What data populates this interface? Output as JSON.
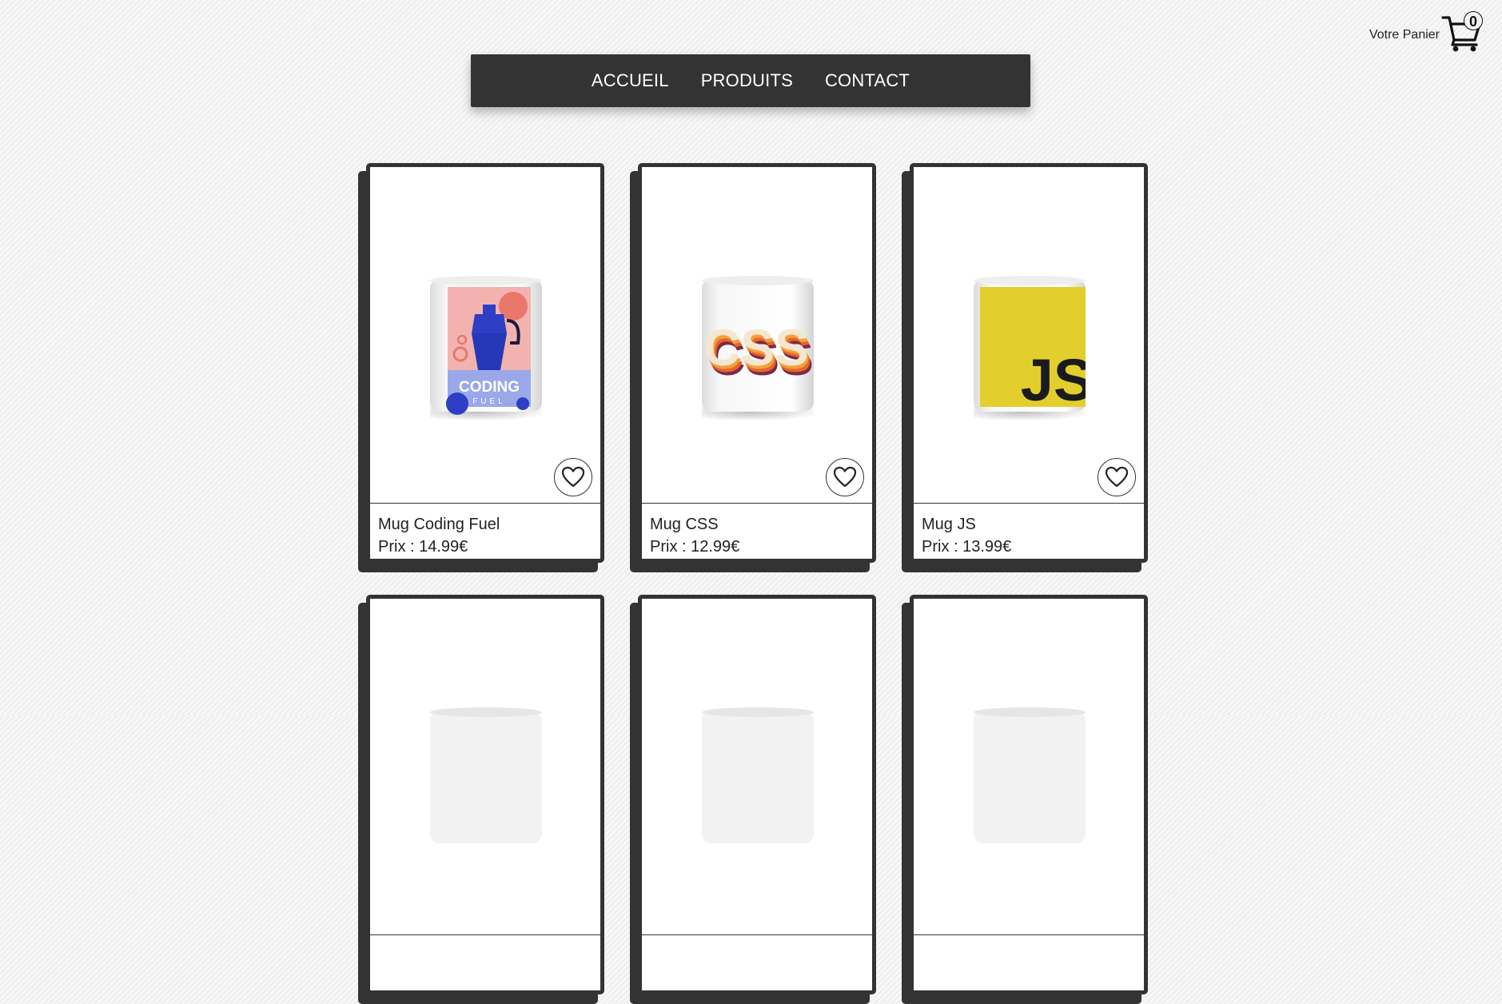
{
  "cart": {
    "label": "Votre Panier",
    "count": "0",
    "icon": "cart-icon"
  },
  "nav": {
    "items": [
      {
        "label": "ACCUEIL"
      },
      {
        "label": "PRODUITS"
      },
      {
        "label": "CONTACT"
      }
    ]
  },
  "products": [
    {
      "name": "Mug Coding Fuel",
      "price": "Prix : 14.99€",
      "design": "coding-fuel",
      "mug_text": "CODING",
      "mug_subtext": "FUEL"
    },
    {
      "name": "Mug CSS",
      "price": "Prix : 12.99€",
      "design": "css",
      "mug_text": "CSS"
    },
    {
      "name": "Mug JS",
      "price": "Prix : 13.99€",
      "design": "js",
      "mug_text": "JS"
    },
    {
      "name": "",
      "price": "",
      "design": "plain"
    },
    {
      "name": "",
      "price": "",
      "design": "plain"
    },
    {
      "name": "",
      "price": "",
      "design": "plain"
    }
  ],
  "colors": {
    "nav_bg": "#333333",
    "card_border": "#333333",
    "js_yellow": "#E2CF2E",
    "coding_blue": "#2D3FC4",
    "coding_pink": "#F2B3B0",
    "css_orange": "#E8642A"
  }
}
